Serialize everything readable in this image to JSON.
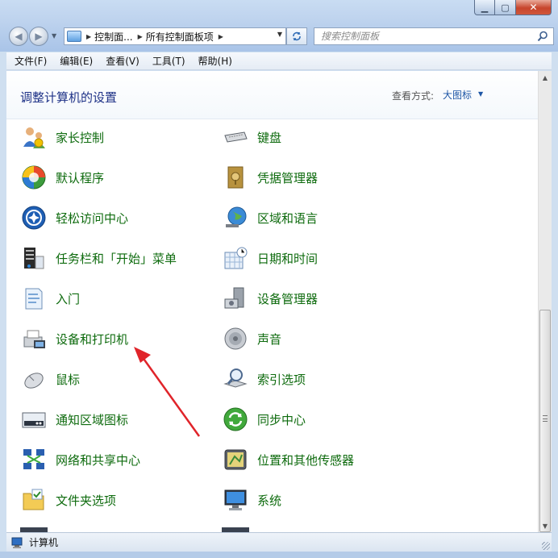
{
  "window": {
    "minimize_glyph": "▁",
    "maximize_glyph": "▢",
    "close_glyph": "✕"
  },
  "nav": {
    "back_glyph": "◀",
    "forward_glyph": "▶",
    "breadcrumbs": [
      "控制面...",
      "所有控制面板项"
    ],
    "search_placeholder": "搜索控制面板"
  },
  "menu": [
    "文件(F)",
    "编辑(E)",
    "查看(V)",
    "工具(T)",
    "帮助(H)"
  ],
  "header": {
    "title": "调整计算机的设置",
    "view_label": "查看方式:",
    "view_value": "大图标"
  },
  "items_left": [
    {
      "label": "家长控制",
      "icon": "parental-controls-icon"
    },
    {
      "label": "默认程序",
      "icon": "default-programs-icon"
    },
    {
      "label": "轻松访问中心",
      "icon": "ease-of-access-icon"
    },
    {
      "label": "任务栏和「开始」菜单",
      "icon": "taskbar-start-menu-icon"
    },
    {
      "label": "入门",
      "icon": "getting-started-icon"
    },
    {
      "label": "设备和打印机",
      "icon": "devices-printers-icon"
    },
    {
      "label": "鼠标",
      "icon": "mouse-icon"
    },
    {
      "label": "通知区域图标",
      "icon": "notification-area-icon"
    },
    {
      "label": "网络和共享中心",
      "icon": "network-sharing-icon"
    },
    {
      "label": "文件夹选项",
      "icon": "folder-options-icon"
    }
  ],
  "items_right": [
    {
      "label": "键盘",
      "icon": "keyboard-icon"
    },
    {
      "label": "凭据管理器",
      "icon": "credential-manager-icon"
    },
    {
      "label": "区域和语言",
      "icon": "region-language-icon"
    },
    {
      "label": "日期和时间",
      "icon": "date-time-icon"
    },
    {
      "label": "设备管理器",
      "icon": "device-manager-icon"
    },
    {
      "label": "声音",
      "icon": "sound-icon"
    },
    {
      "label": "索引选项",
      "icon": "indexing-options-icon"
    },
    {
      "label": "同步中心",
      "icon": "sync-center-icon"
    },
    {
      "label": "位置和其他传感器",
      "icon": "location-sensors-icon"
    },
    {
      "label": "系统",
      "icon": "system-icon"
    }
  ],
  "status": {
    "text": "计算机"
  },
  "colors": {
    "item_label": "#0e6b0e",
    "title": "#1e3287",
    "link": "#1e57a6",
    "annotation_arrow": "#e0242a"
  }
}
